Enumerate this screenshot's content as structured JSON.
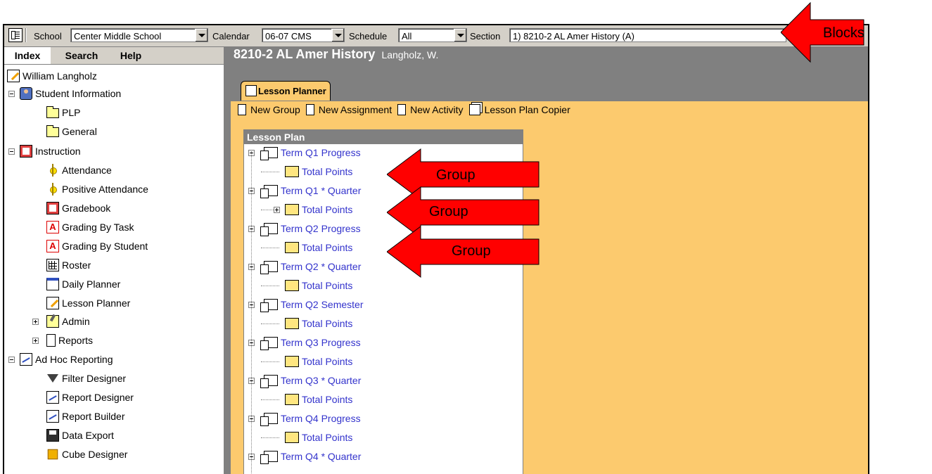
{
  "topbar": {
    "school_label": "School",
    "school_value": "Center Middle School",
    "calendar_label": "Calendar",
    "calendar_value": "06-07 CMS",
    "schedule_label": "Schedule",
    "schedule_value": "All",
    "section_label": "Section",
    "section_value": "1) 8210-2 AL Amer History (A)"
  },
  "left_tabs": [
    "Index",
    "Search",
    "Help"
  ],
  "tree": [
    {
      "label": "William Langholz",
      "icon": "pencil-icon"
    },
    {
      "label": "Student Information",
      "icon": "person-icon"
    },
    {
      "label": "PLP",
      "icon": "folder-icon"
    },
    {
      "label": "General",
      "icon": "folder-icon"
    },
    {
      "label": "Instruction",
      "icon": "book-icon"
    },
    {
      "label": "Attendance",
      "icon": "sun-icon"
    },
    {
      "label": "Positive Attendance",
      "icon": "sun-icon"
    },
    {
      "label": "Gradebook",
      "icon": "gradebook-icon"
    },
    {
      "label": "Grading By Task",
      "icon": "grade-icon"
    },
    {
      "label": "Grading By Student",
      "icon": "grade-icon"
    },
    {
      "label": "Roster",
      "icon": "grid-icon"
    },
    {
      "label": "Daily Planner",
      "icon": "calendar-icon"
    },
    {
      "label": "Lesson Planner",
      "icon": "pencil-icon"
    },
    {
      "label": "Admin",
      "icon": "admin-icon"
    },
    {
      "label": "Reports",
      "icon": "page-icon"
    },
    {
      "label": "Ad Hoc Reporting",
      "icon": "chart-icon"
    },
    {
      "label": "Filter Designer",
      "icon": "filter-icon"
    },
    {
      "label": "Report Designer",
      "icon": "chart-icon"
    },
    {
      "label": "Report Builder",
      "icon": "chart-icon"
    },
    {
      "label": "Data Export",
      "icon": "disk-icon"
    },
    {
      "label": "Cube Designer",
      "icon": "cube-icon"
    }
  ],
  "content": {
    "title": "8210-2 AL Amer History",
    "teacher": "Langholz, W.",
    "tab_label": "Lesson Planner",
    "toolbar": {
      "new_group": "New Group",
      "new_assignment": "New Assignment",
      "new_activity": "New Activity",
      "copier": "Lesson Plan Copier"
    },
    "lesson_plan_header": "Lesson Plan",
    "lesson_plan": [
      {
        "term": "Term Q1 Progress",
        "group": "Total Points"
      },
      {
        "term": "Term Q1 * Quarter",
        "group": "Total Points"
      },
      {
        "term": "Term Q2 Progress",
        "group": "Total Points"
      },
      {
        "term": "Term Q2 * Quarter",
        "group": "Total Points"
      },
      {
        "term": "Term Q2 Semester",
        "group": "Total Points"
      },
      {
        "term": "Term Q3 Progress",
        "group": "Total Points"
      },
      {
        "term": "Term Q3 * Quarter",
        "group": "Total Points"
      },
      {
        "term": "Term Q4 Progress",
        "group": "Total Points"
      },
      {
        "term": "Term Q4 * Quarter",
        "group": ""
      }
    ]
  },
  "annotations": {
    "blocks": "Blocks",
    "group1": "Group",
    "group2": "Group",
    "group3": "Group"
  },
  "colors": {
    "chrome": "#d4d0c8",
    "content_bg": "#808080",
    "workarea": "#fcca6e",
    "link": "#3333cc",
    "arrow": "#ff0000"
  }
}
